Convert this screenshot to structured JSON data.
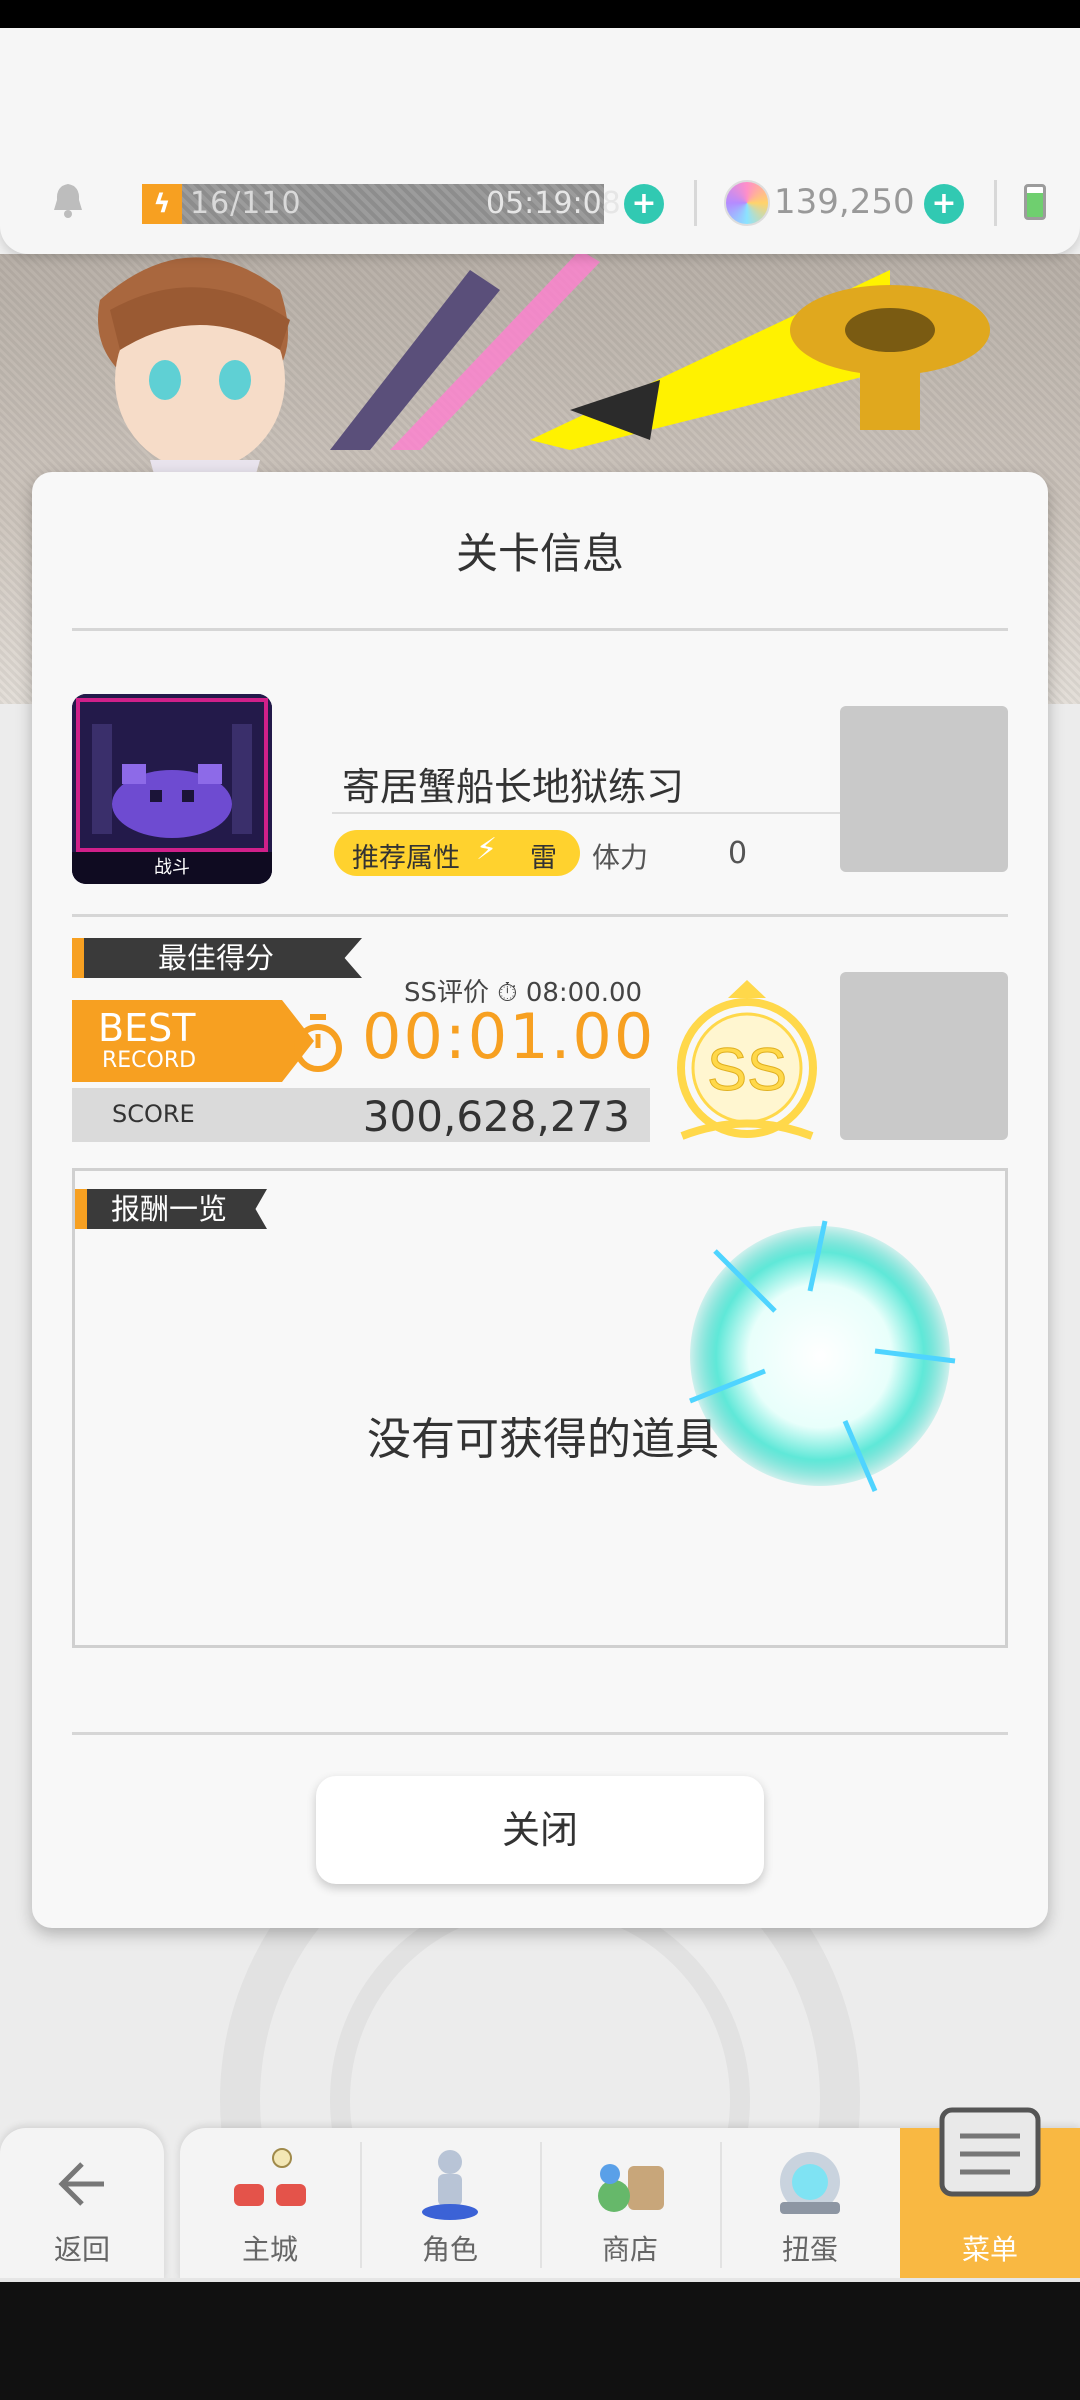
{
  "header": {
    "stamina_text": "16/110",
    "stamina_timer": "05:19:08",
    "gem_count": "139,250"
  },
  "modal": {
    "title": "关卡信息",
    "stage": {
      "thumb_label": "战斗",
      "name": "寄居蟹船长地狱练习",
      "recommended_attr_label": "推荐属性",
      "recommended_attr_value": "雷",
      "stamina_label": "体力",
      "stamina_cost": "0"
    },
    "best_score": {
      "section_label": "最佳得分",
      "ss_criterion": "SS评价 ⏱ 08:00.00",
      "badge_line1": "BEST",
      "badge_line2": "RECORD",
      "time": "00:01.00",
      "score_label": "SCORE",
      "score_value": "300,628,273",
      "rank": "SS"
    },
    "rewards": {
      "section_label": "报酬一览",
      "empty_text": "没有可获得的道具"
    },
    "close_label": "关闭"
  },
  "nav": {
    "back": "返回",
    "items": [
      {
        "label": "主城"
      },
      {
        "label": "角色"
      },
      {
        "label": "商店"
      },
      {
        "label": "扭蛋"
      },
      {
        "label": "菜单"
      }
    ]
  },
  "colors": {
    "accent_orange": "#f7a021",
    "attr_yellow": "#ffd22e",
    "plus_teal": "#31c9b2",
    "menu_active": "#f9b842"
  }
}
